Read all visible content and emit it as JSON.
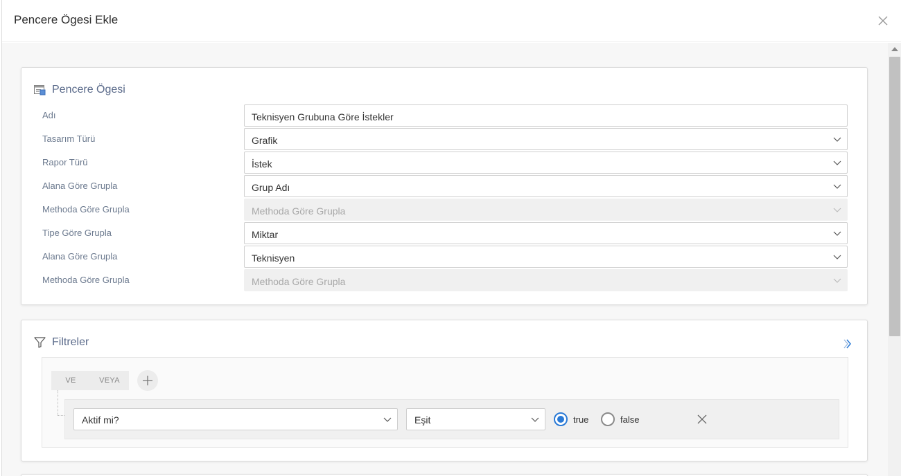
{
  "dialog": {
    "title": "Pencere Ögesi Ekle"
  },
  "window_item": {
    "title": "Pencere Ögesi",
    "fields": [
      {
        "label": "Adı",
        "value": "Teknisyen Grubuna Göre İstekler",
        "type": "text"
      },
      {
        "label": "Tasarım Türü",
        "value": "Grafik",
        "type": "select"
      },
      {
        "label": "Rapor Türü",
        "value": "İstek",
        "type": "select"
      },
      {
        "label": "Alana Göre Grupla",
        "value": "Grup Adı",
        "type": "select"
      },
      {
        "label": "Methoda Göre Grupla",
        "value": "Methoda Göre Grupla",
        "type": "select",
        "disabled": true
      },
      {
        "label": "Tipe Göre Grupla",
        "value": "Miktar",
        "type": "select"
      },
      {
        "label": "Alana Göre Grupla",
        "value": "Teknisyen",
        "type": "select"
      },
      {
        "label": "Methoda Göre Grupla",
        "value": "Methoda Göre Grupla",
        "type": "select",
        "disabled": true
      }
    ]
  },
  "filters": {
    "title": "Filtreler",
    "logic": {
      "and": "VE",
      "or": "VEYA"
    },
    "rule": {
      "field": "Aktif mi?",
      "operator": "Eşit",
      "options": [
        {
          "label": "true",
          "checked": true
        },
        {
          "label": "false",
          "checked": false
        }
      ]
    }
  },
  "colors": {
    "accent": "#2a7ad6",
    "label": "#6c7a8f",
    "heading": "#5a6a8a"
  }
}
